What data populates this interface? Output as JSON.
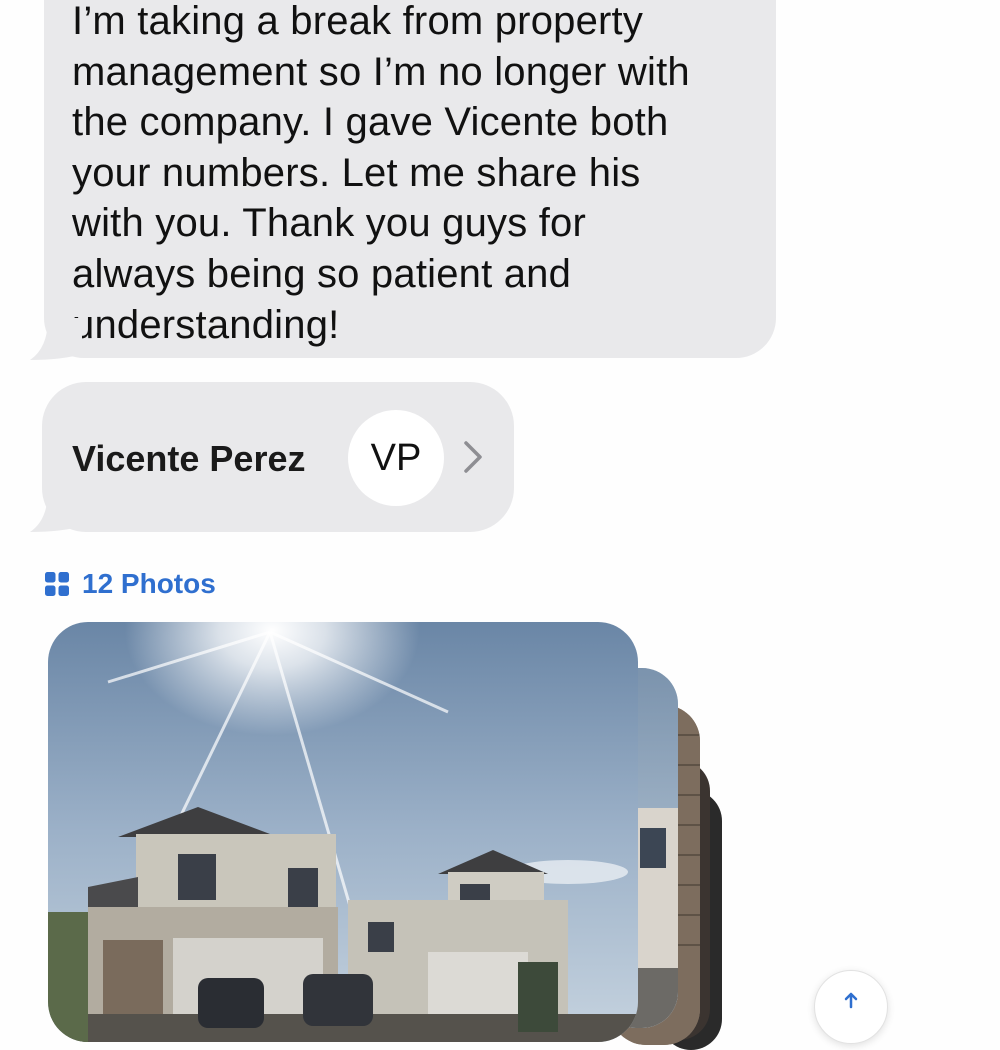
{
  "message": {
    "text": "I’m taking a break from property\nmanagement so I’m no longer with\nthe company. I gave Vicente both\nyour numbers. Let me share his\nwith you. Thank you guys for\nalways being so patient and\nunderstanding!"
  },
  "contact_card": {
    "name": "Vicente Perez",
    "initials": "VP",
    "chevron_icon": "chevron-right-icon"
  },
  "photos": {
    "label": "12 Photos",
    "icon": "photo-grid-icon",
    "accent_color": "#2f6fcf",
    "main_photo_subject": "two-story houses under bright sun"
  },
  "colors": {
    "bubble": "#e9e9eb",
    "background": "#fefefe"
  }
}
